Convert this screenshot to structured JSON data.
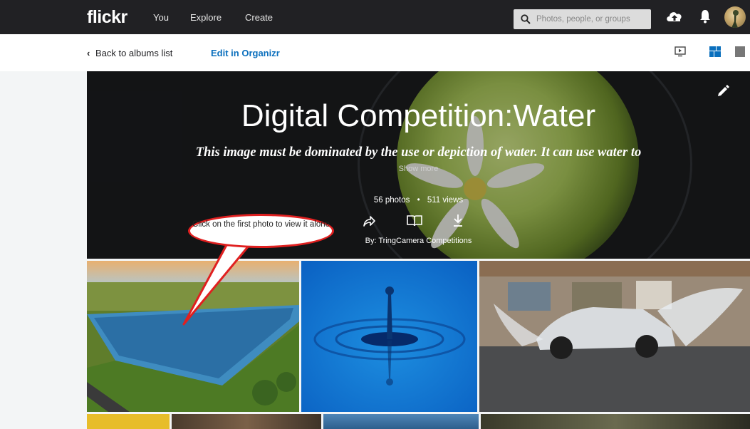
{
  "topbar": {
    "logo": "flickr",
    "nav": [
      "You",
      "Explore",
      "Create"
    ],
    "search_placeholder": "Photos, people, or groups"
  },
  "subbar": {
    "back_label": "Back to albums list",
    "edit_label": "Edit in Organizr"
  },
  "album": {
    "title": "Digital Competition:Water",
    "description": "This image must be dominated by the use or depiction of water. It can use water to",
    "show_more": "Show more",
    "photo_count": "56 photos",
    "separator": "•",
    "views": "511 views",
    "by": "By: TringCamera Competitions"
  },
  "callout": {
    "text": "Click on the first photo to view it alone"
  },
  "colors": {
    "topbar": "#212124",
    "link_blue": "#0a6fbd",
    "callout_red": "#e02020"
  },
  "icons": [
    "search-icon",
    "upload-icon",
    "bell-icon",
    "slideshow-icon",
    "grid-view-icon",
    "list-view-icon",
    "share-icon",
    "book-icon",
    "download-icon",
    "pencil-icon"
  ]
}
